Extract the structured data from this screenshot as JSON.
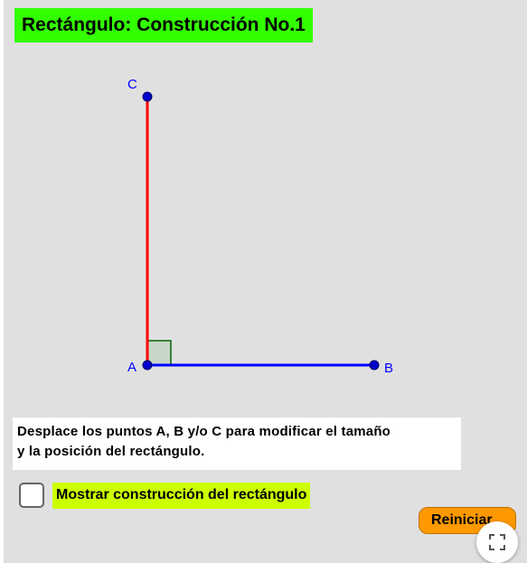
{
  "title": "Rectángulo: Construcción No.1",
  "points": {
    "a": "A",
    "b": "B",
    "c": "C"
  },
  "instructions": {
    "line1": "Desplace los puntos A, B  y/o C para modificar el tamaño",
    "line2": "y la posición del rectángulo."
  },
  "checkbox": {
    "label": "Mostrar construcción del rectángulo",
    "checked": false
  },
  "reset_button": {
    "label": "Reiniciar"
  },
  "colors": {
    "title_bg": "#33ff00",
    "segment_ac": "#ff0000",
    "segment_ab": "#0000ff",
    "points": "#0000cc",
    "right_angle_mark": "#006600",
    "checkbox_label_bg": "#ccff00",
    "reset_bg": "#ff9900",
    "background": "#e0e0e0"
  },
  "icons": {
    "fullscreen": "fullscreen-icon"
  }
}
